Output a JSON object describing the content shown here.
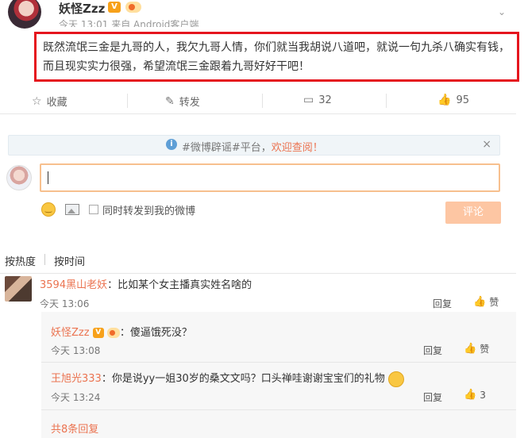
{
  "post": {
    "username": "妖怪Zzz",
    "vip_badge": "V",
    "meta": "今天 13:01 来自 Android客户端",
    "more": "⌄",
    "text": "既然流氓三金是九哥的人，我欠九哥人情，你们就当我胡说八道吧，就说一句九杀八确实有钱，而且现实实力很强，希望流氓三金跟着九哥好好干吧！"
  },
  "actions": {
    "favorite": "收藏",
    "repost": "转发",
    "comments": "32",
    "likes": "95"
  },
  "notice": {
    "prefix": "#微博辟谣#平台，",
    "link": "欢迎查阅！",
    "close": "×"
  },
  "compose": {
    "repost_checkbox_label": "同时转发到我的微博",
    "submit": "评论"
  },
  "sort": {
    "hot": "按热度",
    "time": "按时间"
  },
  "comments": [
    {
      "user": "3594黑山老妖",
      "text": "：比如某个女主播真实姓名啥的",
      "time": "今天 13:06",
      "reply": "回复",
      "like": "赞"
    }
  ],
  "replies": [
    {
      "user": "妖怪Zzz",
      "vip": "V",
      "text": "：傻逼饿死没？",
      "time": "今天 13:08",
      "reply": "回复",
      "like": "赞"
    },
    {
      "user": "王旭光333",
      "text": "：你是说yy一姐30岁的桑文文吗？口头禅哇谢谢宝宝们的礼物",
      "time": "今天 13:24",
      "reply": "回复",
      "like": "3"
    }
  ],
  "more_replies": "共8条回复"
}
